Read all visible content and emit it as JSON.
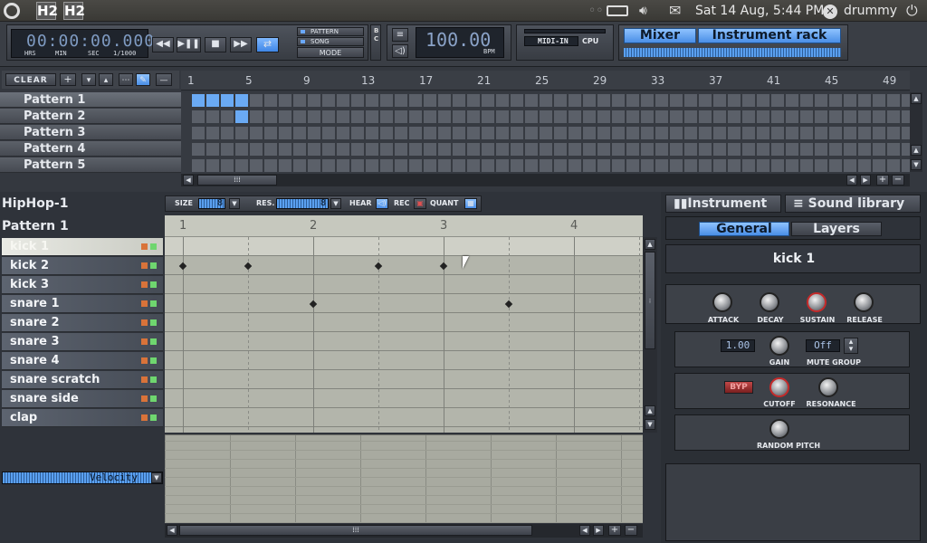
{
  "topbar": {
    "datetime": "Sat 14 Aug,  5:44 PM",
    "user": "drummy",
    "apps": [
      "H2",
      "H2"
    ]
  },
  "transport": {
    "time": "00:00:00.000",
    "time_labels": [
      "HRS",
      "MIN",
      "SEC",
      "1/1000"
    ],
    "mode_pattern": "PATTERN",
    "mode_song": "SONG",
    "mode_label": "MODE",
    "bc_b": "B",
    "bc_c": "C",
    "bpm_value": "100.00",
    "bpm_label": "BPM",
    "midi_in": "MIDI-IN",
    "cpu": "CPU",
    "mixer": "Mixer",
    "instrument_rack": "Instrument rack"
  },
  "song_editor": {
    "clear": "CLEAR",
    "patterns": [
      "Pattern 1",
      "Pattern 2",
      "Pattern 3",
      "Pattern 4",
      "Pattern 5"
    ],
    "ruler": [
      "1",
      "5",
      "9",
      "13",
      "17",
      "21",
      "25",
      "29",
      "33",
      "37",
      "41",
      "45",
      "49"
    ]
  },
  "pattern_editor": {
    "song_name": "HipHop-1",
    "pattern_name": "Pattern 1",
    "size_label": "SIZE",
    "size_value": "8",
    "res_label": "RES.",
    "res_value": "8",
    "hear": "HEAR",
    "rec": "REC",
    "quant": "QUANT",
    "beats": [
      "1",
      "2",
      "3",
      "4"
    ],
    "instruments": [
      "kick 1",
      "kick 2",
      "kick 3",
      "snare 1",
      "snare 2",
      "snare 3",
      "snare 4",
      "snare scratch",
      "snare side",
      "clap"
    ],
    "velocity": "Velocity"
  },
  "instrument_panel": {
    "tab_instrument": "Instrument",
    "tab_sound_library": "Sound library",
    "tab_general": "General",
    "tab_layers": "Layers",
    "name": "kick 1",
    "attack": "ATTACK",
    "decay": "DECAY",
    "sustain": "SUSTAIN",
    "release": "RELEASE",
    "gain_value": "1.00",
    "gain": "GAIN",
    "mute_value": "Off",
    "mute_group": "MUTE GROUP",
    "byp": "BYP",
    "cutoff": "CUTOFF",
    "resonance": "RESONANCE",
    "random_pitch": "RANDOM PITCH"
  }
}
